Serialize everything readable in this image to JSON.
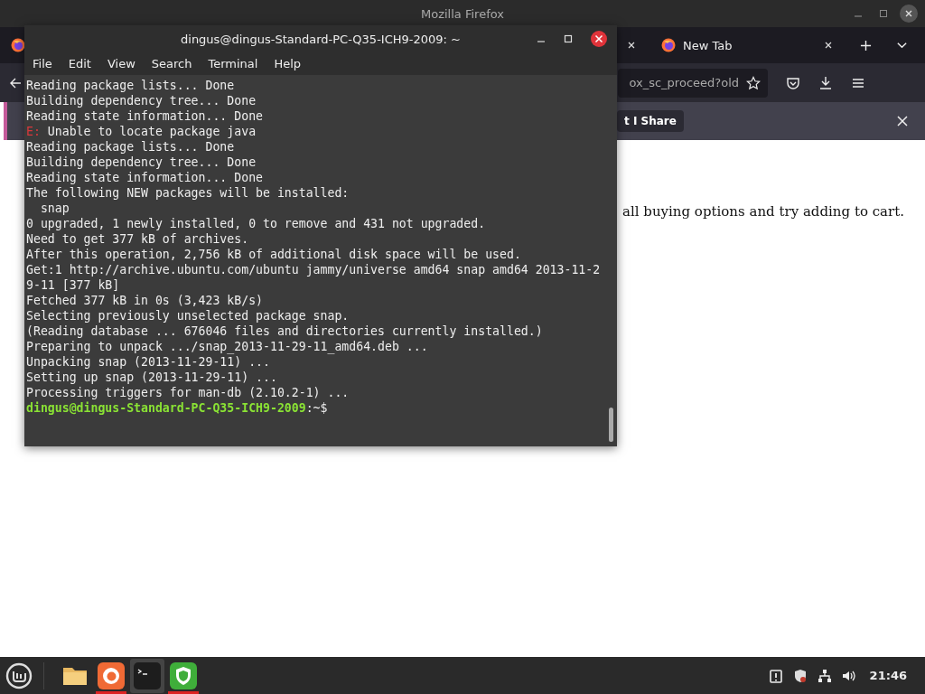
{
  "browser": {
    "title": "Mozilla Firefox",
    "tabs": [
      {
        "kind": "hidden"
      },
      {
        "label": "New Tab"
      }
    ],
    "url": "ox_sc_proceed?old",
    "notification": {
      "button": "t I Share"
    },
    "page_text": "all buying options and try adding to cart."
  },
  "terminal": {
    "title": "dingus@dingus-Standard-PC-Q35-ICH9-2009: ~",
    "menu": [
      "File",
      "Edit",
      "View",
      "Search",
      "Terminal",
      "Help"
    ],
    "lines": [
      {
        "kind": "plain",
        "text": "Reading package lists... Done"
      },
      {
        "kind": "plain",
        "text": "Building dependency tree... Done"
      },
      {
        "kind": "plain",
        "text": "Reading state information... Done"
      },
      {
        "kind": "error",
        "prefix": "E:",
        "text": " Unable to locate package java"
      },
      {
        "kind": "plain",
        "text": "Reading package lists... Done"
      },
      {
        "kind": "plain",
        "text": "Building dependency tree... Done"
      },
      {
        "kind": "plain",
        "text": "Reading state information... Done"
      },
      {
        "kind": "plain",
        "text": "The following NEW packages will be installed:"
      },
      {
        "kind": "plain",
        "text": "  snap"
      },
      {
        "kind": "plain",
        "text": "0 upgraded, 1 newly installed, 0 to remove and 431 not upgraded."
      },
      {
        "kind": "plain",
        "text": "Need to get 377 kB of archives."
      },
      {
        "kind": "plain",
        "text": "After this operation, 2,756 kB of additional disk space will be used."
      },
      {
        "kind": "plain",
        "text": "Get:1 http://archive.ubuntu.com/ubuntu jammy/universe amd64 snap amd64 2013-11-2"
      },
      {
        "kind": "plain",
        "text": "9-11 [377 kB]"
      },
      {
        "kind": "plain",
        "text": "Fetched 377 kB in 0s (3,423 kB/s)"
      },
      {
        "kind": "plain",
        "text": "Selecting previously unselected package snap."
      },
      {
        "kind": "plain",
        "text": "(Reading database ... 676046 files and directories currently installed.)"
      },
      {
        "kind": "plain",
        "text": "Preparing to unpack .../snap_2013-11-29-11_amd64.deb ..."
      },
      {
        "kind": "plain",
        "text": "Unpacking snap (2013-11-29-11) ..."
      },
      {
        "kind": "plain",
        "text": "Setting up snap (2013-11-29-11) ..."
      },
      {
        "kind": "plain",
        "text": "Processing triggers for man-db (2.10.2-1) ..."
      },
      {
        "kind": "prompt",
        "prefix": "dingus@dingus-Standard-PC-Q35-ICH9-2009",
        "text": ":~$"
      }
    ]
  },
  "taskbar": {
    "apps": [
      {
        "kind": "folder",
        "running": false,
        "selected": false
      },
      {
        "kind": "firefox",
        "running": true,
        "selected": false
      },
      {
        "kind": "terminal",
        "running": false,
        "selected": true
      },
      {
        "kind": "shield",
        "running": true,
        "selected": false
      }
    ],
    "clock": "21:46"
  }
}
